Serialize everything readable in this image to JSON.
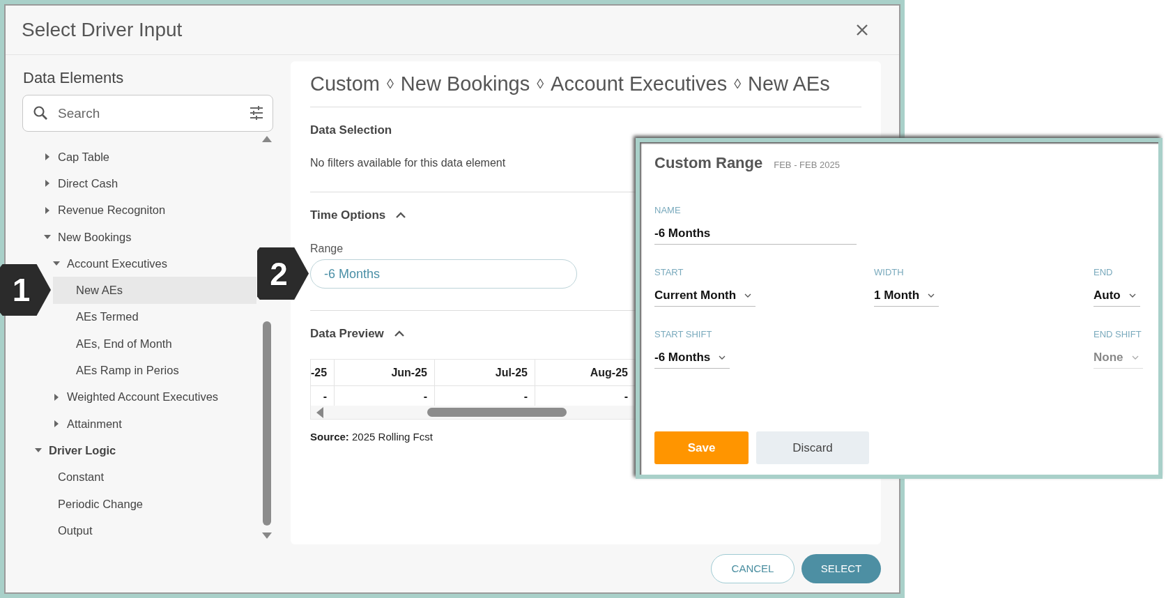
{
  "window": {
    "title": "Select Driver Input"
  },
  "sidebar": {
    "heading": "Data Elements",
    "search": {
      "placeholder": "Search"
    },
    "tree": [
      {
        "children": [
          {
            "label": "Cap Table",
            "expanded": false,
            "selected": false
          },
          {
            "label": "Direct Cash",
            "expanded": false,
            "selected": false
          },
          {
            "label": "Revenue Recogniton",
            "expanded": false,
            "selected": false
          },
          {
            "label": "New Bookings",
            "expanded": true,
            "selected": false,
            "children": [
              {
                "label": "Account Executives",
                "expanded": true,
                "selected": false,
                "children": [
                  {
                    "label": "New AEs",
                    "selected": true
                  },
                  {
                    "label": "AEs Termed",
                    "selected": false
                  },
                  {
                    "label": "AEs, End of Month",
                    "selected": false
                  },
                  {
                    "label": "AEs Ramp in Perios",
                    "selected": false
                  }
                ]
              },
              {
                "label": "Weighted Account Executives",
                "expanded": false,
                "selected": false
              },
              {
                "label": "Attainment",
                "expanded": false,
                "selected": false
              }
            ]
          }
        ]
      },
      {
        "label": "Driver Logic",
        "expanded": true,
        "selected": false,
        "children": [
          {
            "label": "Constant",
            "selected": false
          },
          {
            "label": "Periodic Change",
            "selected": false
          },
          {
            "label": "Output",
            "selected": false
          }
        ]
      }
    ]
  },
  "detail": {
    "breadcrumb": [
      "Custom",
      "New Bookings",
      "Account Executives",
      "New AEs"
    ],
    "separator": "◊",
    "data_selection": {
      "title": "Data Selection",
      "message": "No filters available for this data element"
    },
    "time_options": {
      "title": "Time Options",
      "expanded": true,
      "range": {
        "label": "Range",
        "value": "-6 Months"
      }
    },
    "data_preview": {
      "title": "Data Preview",
      "expanded": true,
      "table": {
        "columns": [
          "-25",
          "Jun-25",
          "Jul-25",
          "Aug-25"
        ],
        "rows": [
          [
            "-",
            "-",
            "-",
            "-"
          ]
        ]
      },
      "source": "**Source:** 2025 Rolling Fcst"
    }
  },
  "footer_buttons": [
    {
      "label": "CANCEL",
      "kind": "outline"
    },
    {
      "label": "SELECT",
      "kind": "filled"
    }
  ],
  "callouts": [
    {
      "label": "1"
    },
    {
      "label": "2"
    }
  ],
  "custom_range": {
    "title": "Custom Range",
    "period": "FEB - FEB 2025",
    "name": {
      "label": "NAME",
      "value": "-6 Months"
    },
    "rows": [
      [
        {
          "label": "START",
          "value": "Current Month",
          "disabled": false
        },
        {
          "label": "WIDTH",
          "value": "1 Month",
          "disabled": false
        },
        {
          "label": "END",
          "value": "Auto",
          "disabled": false
        }
      ],
      [
        {
          "label": "START SHIFT",
          "value": "-6 Months",
          "disabled": false
        },
        "",
        {
          "label": "END SHIFT",
          "value": "None",
          "disabled": true
        }
      ]
    ],
    "buttons": [
      {
        "label": "Save",
        "kind": "primary"
      },
      {
        "label": "Discard",
        "kind": "secondary"
      }
    ]
  }
}
